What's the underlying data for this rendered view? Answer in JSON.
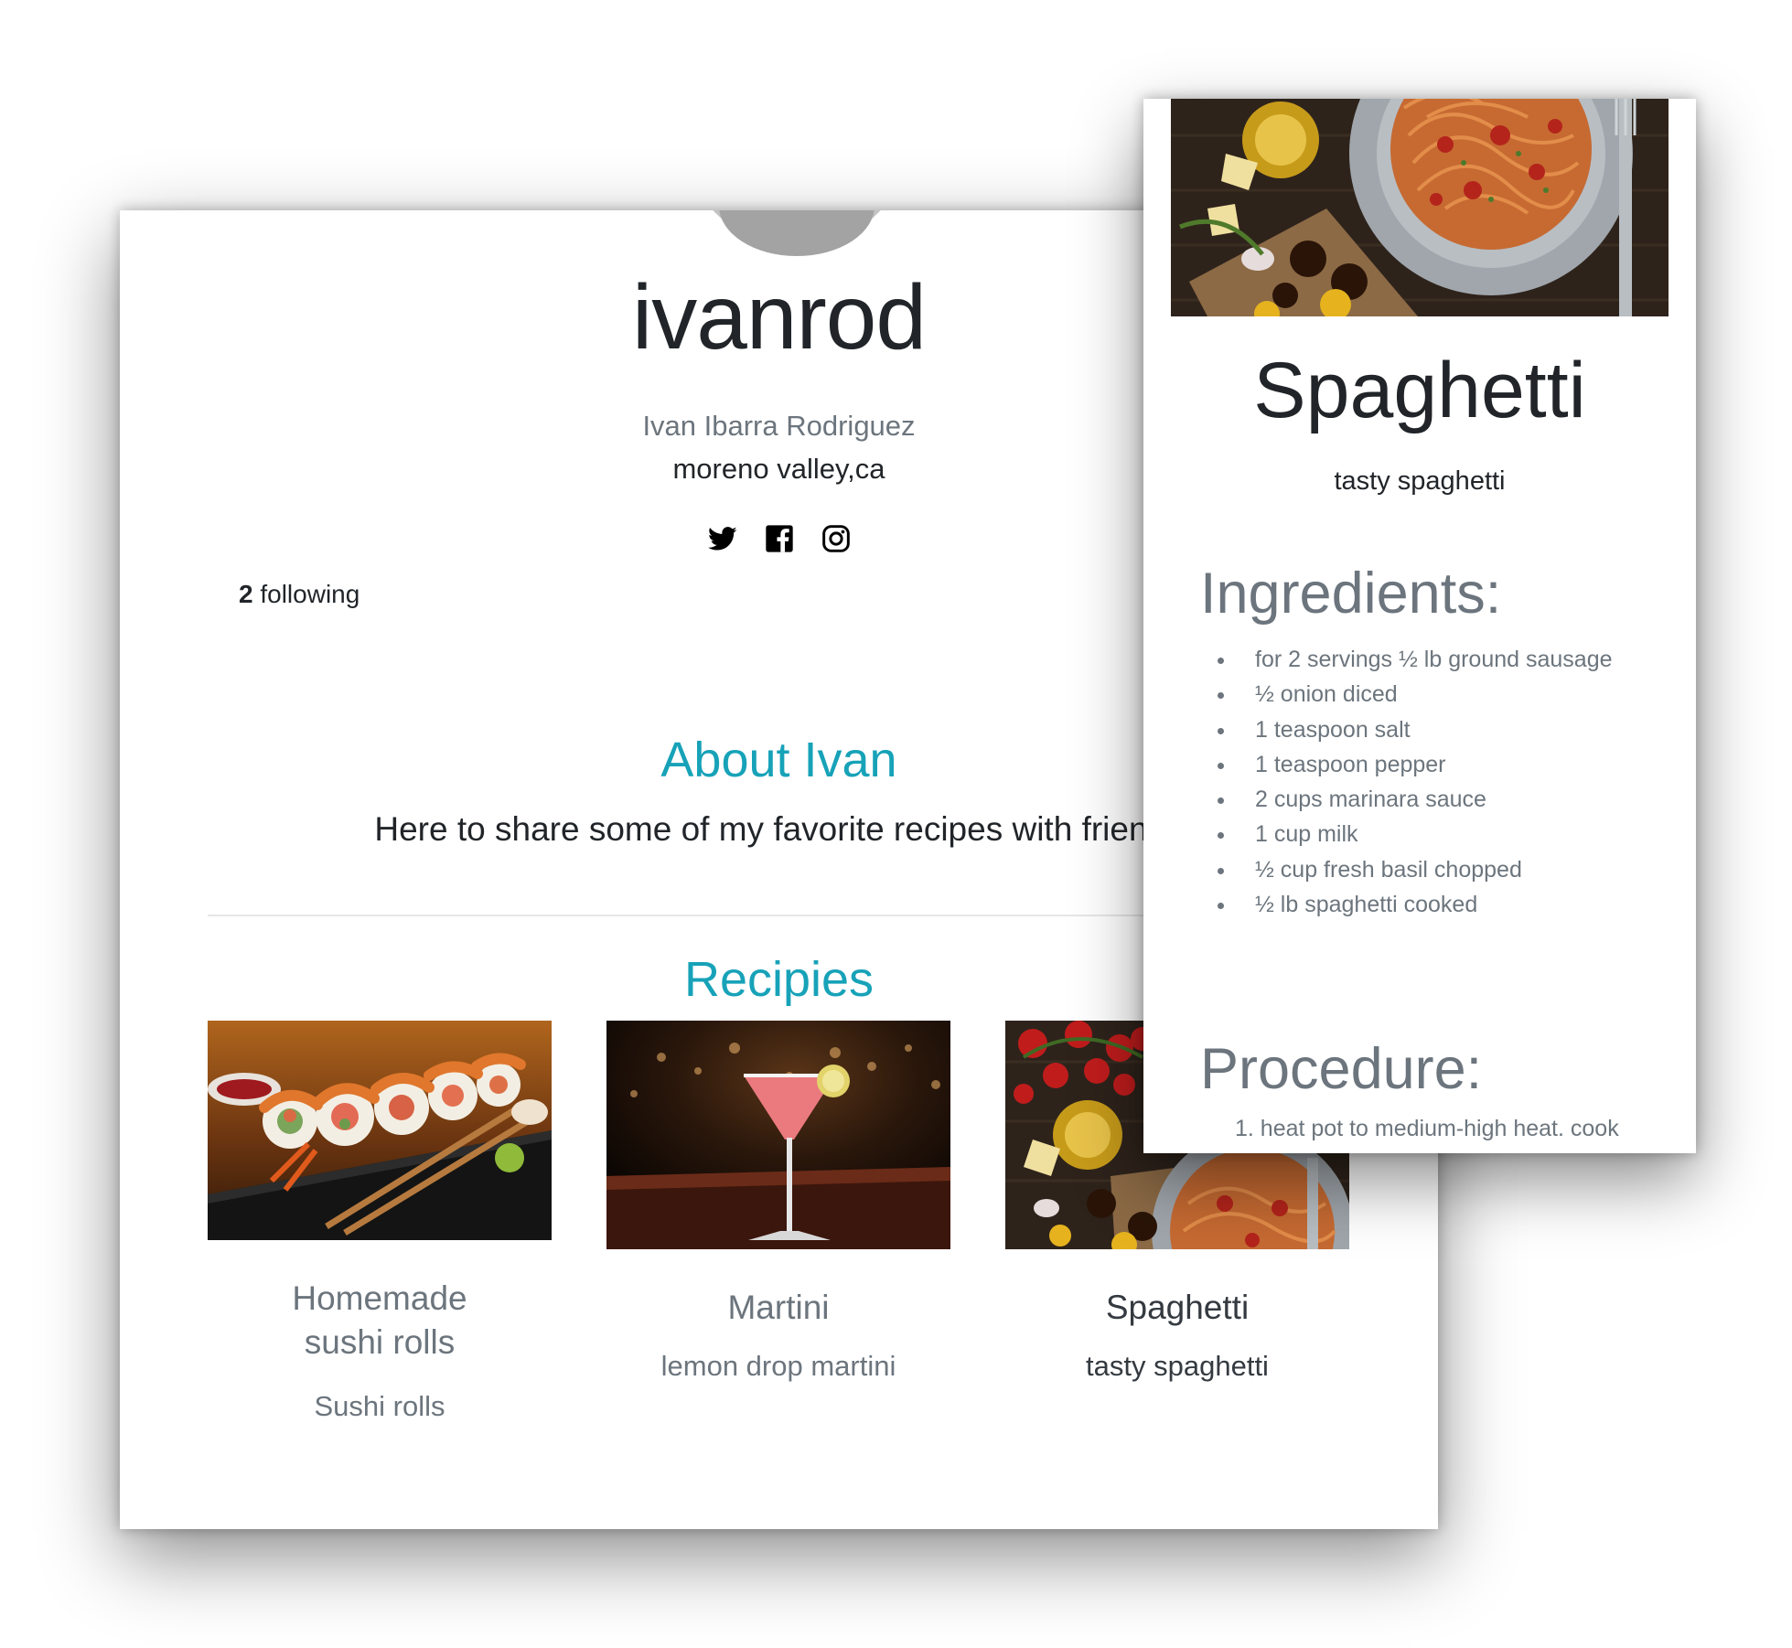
{
  "profile": {
    "username": "ivanrod",
    "full_name": "Ivan Ibarra Rodriguez",
    "location": "moreno valley,ca",
    "following_count": "2",
    "following_label": " following",
    "socials": [
      {
        "name": "twitter-icon"
      },
      {
        "name": "facebook-icon"
      },
      {
        "name": "instagram-icon"
      }
    ]
  },
  "about": {
    "heading": "About Ivan",
    "text": "Here to share some of my favorite recipes with friends"
  },
  "recipes": {
    "heading": "Recipies",
    "items": [
      {
        "title": "Homemade sushi rolls",
        "subtitle": "Sushi rolls",
        "image": "sushi-rolls-photo"
      },
      {
        "title": "Martini",
        "subtitle": "lemon drop martini",
        "image": "martini-photo"
      },
      {
        "title": "Spaghetti",
        "subtitle": "tasty spaghetti",
        "image": "spaghetti-photo"
      }
    ]
  },
  "detail": {
    "title": "Spaghetti",
    "subtitle": "tasty spaghetti",
    "ingredients_heading": "Ingredients:",
    "ingredients": [
      "for 2 servings ½ lb ground sausage",
      "½ onion diced",
      "1 teaspoon salt",
      "1 teaspoon pepper",
      "2 cups marinara sauce",
      "1 cup milk",
      "½ cup fresh basil chopped",
      "½ lb spaghetti cooked"
    ],
    "procedure_heading": "Procedure:",
    "procedure": [
      "1. heat pot to medium-high heat. cook"
    ]
  },
  "colors": {
    "accent": "#17a2b8",
    "muted": "#6c757d",
    "text": "#212529"
  }
}
